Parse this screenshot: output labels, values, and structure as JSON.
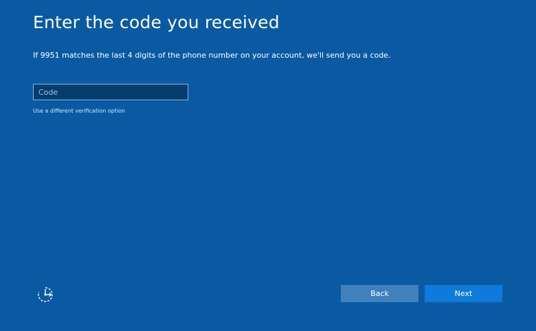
{
  "page": {
    "title": "Enter the code you received",
    "instructions": "If 9951 matches the last 4 digits of the phone number on your account, we'll send you a code."
  },
  "code_field": {
    "placeholder": "Code",
    "value": ""
  },
  "links": {
    "different_option": "Use a different verification option"
  },
  "footer": {
    "ease_of_access_icon": "ease-of-access-icon",
    "back_label": "Back",
    "next_label": "Next"
  },
  "colors": {
    "background": "#0a5aa3",
    "input_background": "#063d6f",
    "back_button": "#3f80bd",
    "next_button": "#0e7adb",
    "text": "#ffffff"
  }
}
